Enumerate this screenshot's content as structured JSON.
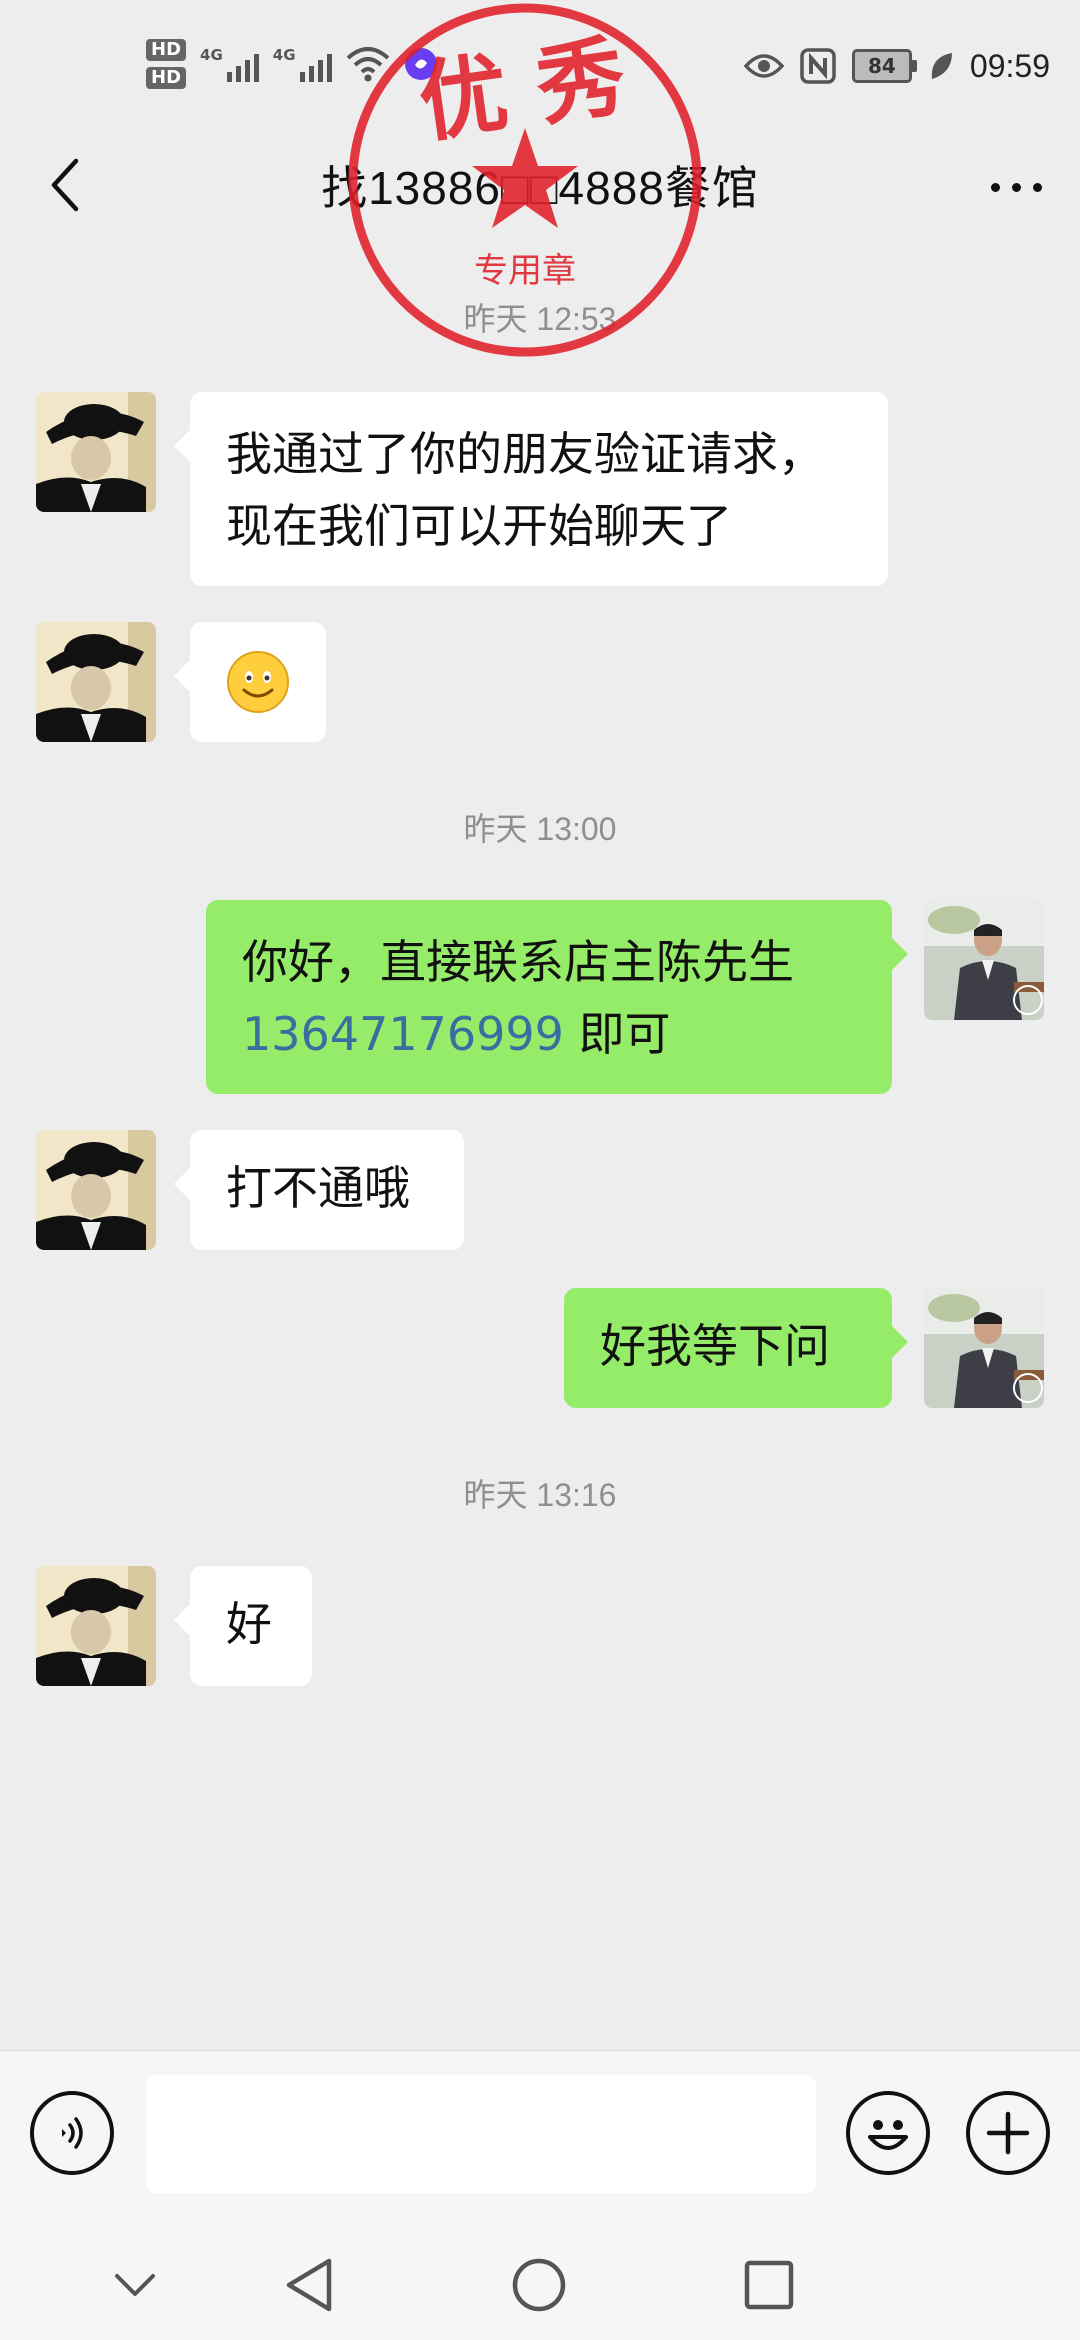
{
  "status_bar": {
    "hd1": "HD",
    "hd2": "HD",
    "net1": "4G",
    "net2": "4G",
    "battery": "84",
    "time": "09:59"
  },
  "header": {
    "title": "找13886□□4888餐馆",
    "back_icon": "chevron-left-icon",
    "more_icon": "more-dots-icon"
  },
  "stamp": {
    "top_text": "优 秀",
    "bottom_text": "专用章",
    "color": "#e0202a"
  },
  "messages": [
    {
      "type": "time",
      "text": "昨天 12:53"
    },
    {
      "type": "in",
      "line1": "我通过了你的朋友验证请求，",
      "line2": "现在我们可以开始聊天了"
    },
    {
      "type": "in",
      "emoji": "smile-emoji"
    },
    {
      "type": "time",
      "text": "昨天 13:00"
    },
    {
      "type": "out",
      "line1": "你好，直接联系店主陈先生",
      "phone": "13647176999",
      "line2_suffix": " 即可"
    },
    {
      "type": "in",
      "text": "打不通哦"
    },
    {
      "type": "out",
      "text": "好我等下问"
    },
    {
      "type": "time",
      "text": "昨天 13:16"
    },
    {
      "type": "in",
      "text": "好"
    }
  ],
  "colors": {
    "outgoing_bubble": "#95ec69",
    "incoming_bubble": "#ffffff",
    "background": "#ededed",
    "link": "#3b6da0"
  },
  "input_bar": {
    "voice_icon": "voice-icon",
    "emoji_icon": "emoji-icon",
    "plus_icon": "plus-icon"
  }
}
